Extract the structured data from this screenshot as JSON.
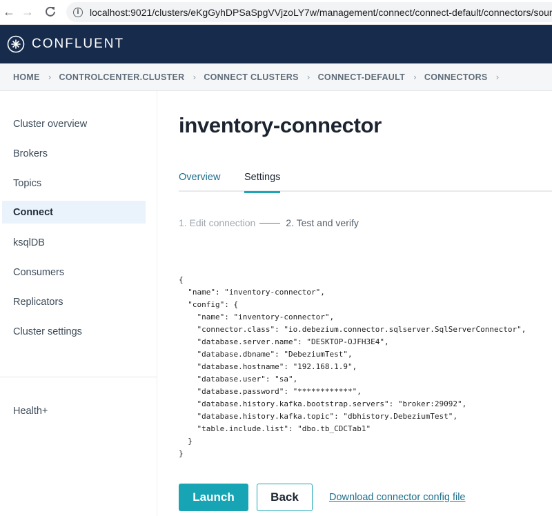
{
  "browser": {
    "url": "localhost:9021/clusters/eKgGyhDPSaSpgVVjzoLY7w/management/connect/connect-default/connectors/source/inventory-connector"
  },
  "app": {
    "brand": "CONFLUENT",
    "brand_color": "#172b4d",
    "accent_color": "#17a5b5"
  },
  "breadcrumb": [
    "HOME",
    "CONTROLCENTER.CLUSTER",
    "CONNECT CLUSTERS",
    "CONNECT-DEFAULT",
    "CONNECTORS"
  ],
  "sidebar": {
    "items": [
      {
        "label": "Cluster overview"
      },
      {
        "label": "Brokers"
      },
      {
        "label": "Topics"
      },
      {
        "label": "Connect"
      },
      {
        "label": "ksqlDB"
      },
      {
        "label": "Consumers"
      },
      {
        "label": "Replicators"
      },
      {
        "label": "Cluster settings"
      }
    ],
    "active": "Connect",
    "health_label": "Health+"
  },
  "main": {
    "title": "inventory-connector",
    "tabs": [
      {
        "label": "Overview"
      },
      {
        "label": "Settings"
      }
    ],
    "active_tab": "Settings",
    "steps": {
      "step1": "1. Edit connection",
      "step2": "2. Test and verify"
    },
    "config_json": "{\n  \"name\": \"inventory-connector\",\n  \"config\": {\n    \"name\": \"inventory-connector\",\n    \"connector.class\": \"io.debezium.connector.sqlserver.SqlServerConnector\",\n    \"database.server.name\": \"DESKTOP-OJFH3E4\",\n    \"database.dbname\": \"DebeziumTest\",\n    \"database.hostname\": \"192.168.1.9\",\n    \"database.user\": \"sa\",\n    \"database.password\": \"************\",\n    \"database.history.kafka.bootstrap.servers\": \"broker:29092\",\n    \"database.history.kafka.topic\": \"dbhistory.DebeziumTest\",\n    \"table.include.list\": \"dbo.tb_CDCTab1\"\n  }\n}",
    "launch_label": "Launch",
    "back_label": "Back",
    "download_label": "Download connector config file"
  }
}
